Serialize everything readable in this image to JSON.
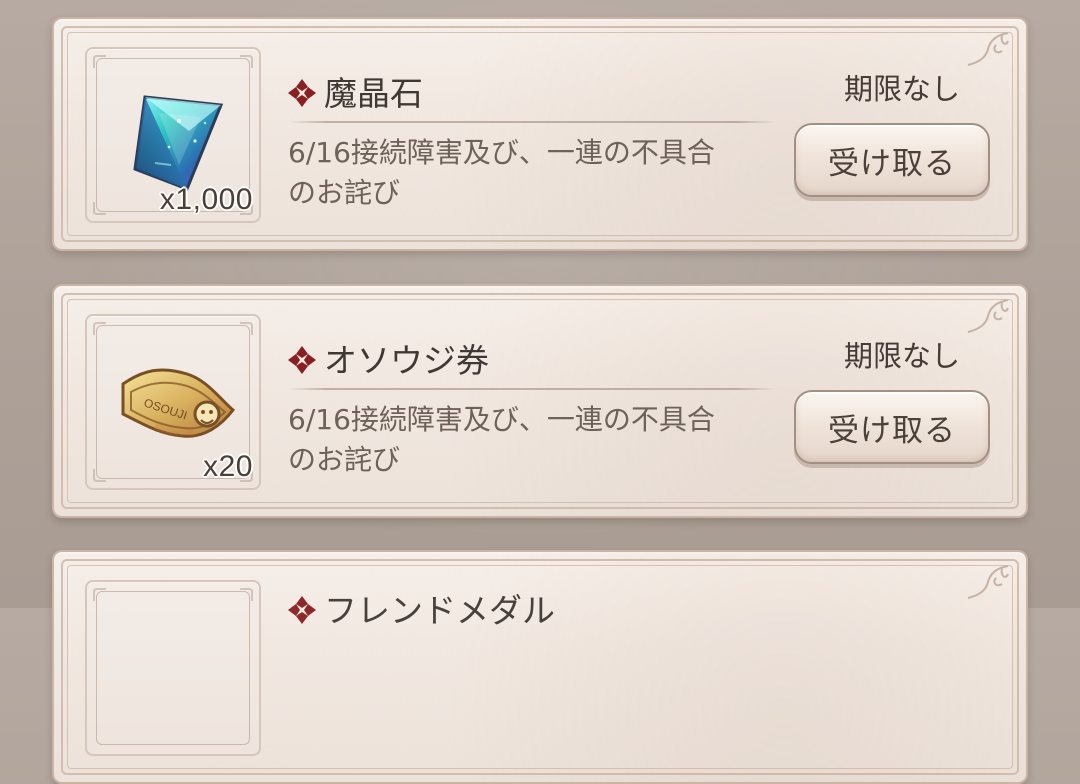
{
  "page": {
    "colors": {
      "background": "#b0a49b",
      "card": "#f1e8e1",
      "card_border": "#c9b4a5",
      "title_text": "#3f3834",
      "message_text": "#6e615a",
      "accent_diamond": "#8a1f1f"
    }
  },
  "gifts": [
    {
      "item_name": "魔晶石",
      "quantity": "x1,000",
      "message": "6/16接続障害及び、一連の不具合\nのお詫び",
      "deadline": "期限なし",
      "receive_label": "受け取る",
      "icon": "magic-crystal-icon"
    },
    {
      "item_name": "オソウジ券",
      "quantity": "x20",
      "message": "6/16接続障害及び、一連の不具合\nのお詫び",
      "deadline": "期限なし",
      "receive_label": "受け取る",
      "icon": "cleaning-ticket-icon"
    },
    {
      "item_name": "フレンドメダル",
      "icon": "friend-medal-icon"
    }
  ]
}
